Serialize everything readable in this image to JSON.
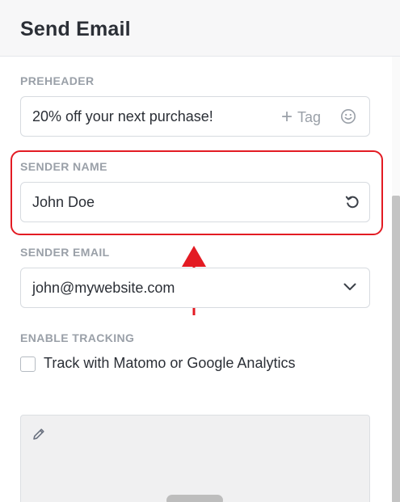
{
  "header": {
    "title": "Send Email"
  },
  "preheader": {
    "label": "PREHEADER",
    "value": "20% off your next purchase!",
    "tag_label": "Tag",
    "tag_icon": "plus-icon",
    "emoji_icon": "smiley-icon"
  },
  "sender_name": {
    "label": "SENDER NAME",
    "value": "John Doe",
    "reset_icon": "reset-icon"
  },
  "sender_email": {
    "label": "SENDER EMAIL",
    "selected": "john@mywebsite.com",
    "dropdown_icon": "chevron-down-icon"
  },
  "tracking": {
    "label": "ENABLE TRACKING",
    "checkbox_label": "Track with Matomo or Google Analytics",
    "checked": false
  },
  "editor": {
    "edit_icon": "pencil-icon"
  },
  "annotation": {
    "highlight_color": "#e31b23",
    "arrow_color": "#e31b23"
  }
}
